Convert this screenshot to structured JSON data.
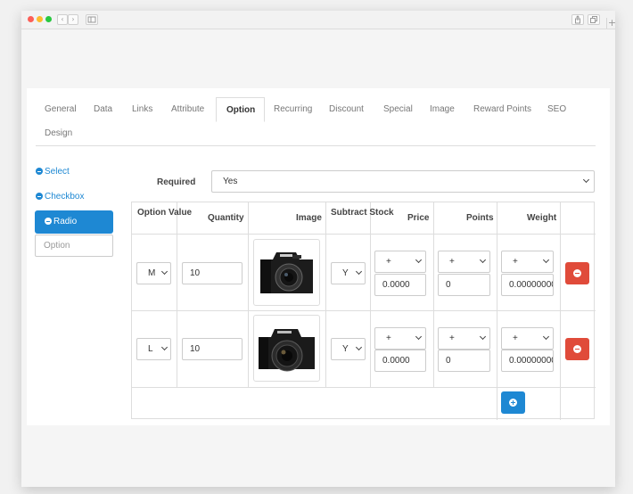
{
  "tabs": [
    "General",
    "Data",
    "Links",
    "Attribute",
    "Option",
    "Recurring",
    "Discount",
    "Special",
    "Image",
    "Reward Points",
    "SEO",
    "Design"
  ],
  "active_tab": "Option",
  "sidebar": {
    "links": [
      "Select",
      "Checkbox"
    ],
    "active": "Radio",
    "option_placeholder": "Option"
  },
  "required": {
    "label": "Required",
    "value": "Yes"
  },
  "table": {
    "headers": {
      "option_value": "Option Value",
      "quantity": "Quantity",
      "image": "Image",
      "subtract_stock": "Subtract Stock",
      "price": "Price",
      "points": "Points",
      "weight": "Weight"
    },
    "rows": [
      {
        "option_value": "M",
        "quantity": "10",
        "image": "camera-photo-icon",
        "subtract": "Y",
        "price_prefix": "+",
        "price": "0.0000",
        "points_prefix": "+",
        "points": "0",
        "weight_prefix": "+",
        "weight": "0.00000000"
      },
      {
        "option_value": "L",
        "quantity": "10",
        "image": "camera-photo-icon",
        "subtract": "Y",
        "price_prefix": "+",
        "price": "0.0000",
        "points_prefix": "+",
        "points": "0",
        "weight_prefix": "+",
        "weight": "0.00000000"
      }
    ]
  },
  "colors": {
    "primary": "#1e88d3",
    "danger": "#e04b3a",
    "border": "#dddddd"
  }
}
